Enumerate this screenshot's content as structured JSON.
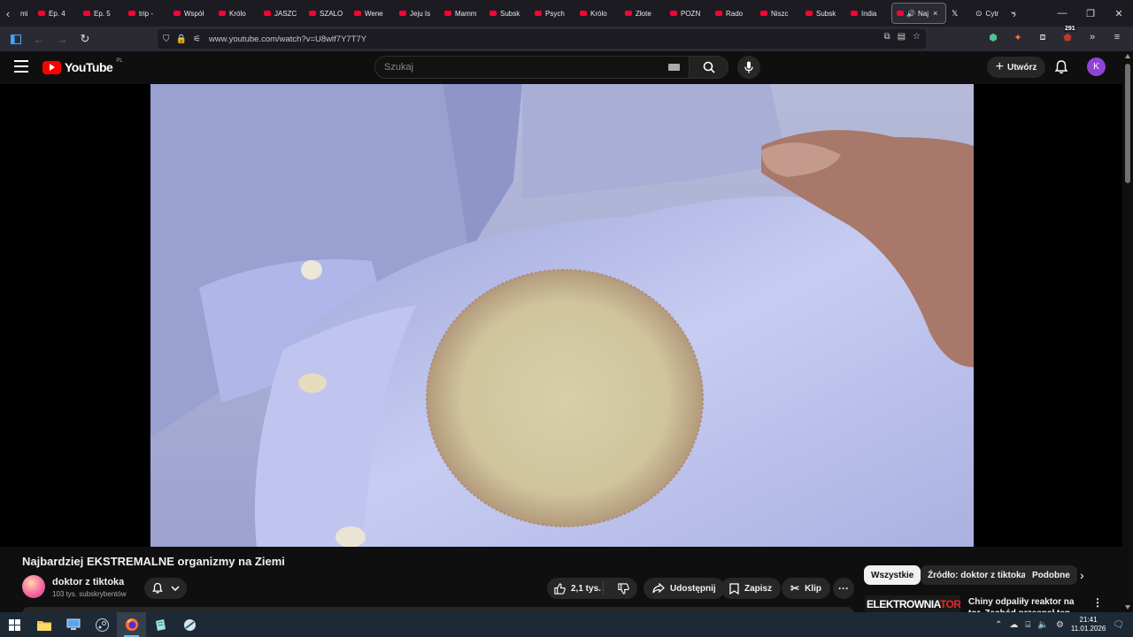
{
  "browser": {
    "tabs": [
      {
        "label": "mi",
        "favicon": "none"
      },
      {
        "label": "Ep. 4",
        "favicon": "youtube-icon"
      },
      {
        "label": "Ep. 5",
        "favicon": "youtube-icon"
      },
      {
        "label": "trip -",
        "favicon": "youtube-icon"
      },
      {
        "label": "Współ",
        "favicon": "youtube-icon"
      },
      {
        "label": "Królo",
        "favicon": "youtube-icon"
      },
      {
        "label": "JASZC",
        "favicon": "youtube-icon"
      },
      {
        "label": "SZALO",
        "favicon": "youtube-icon"
      },
      {
        "label": "Wene",
        "favicon": "youtube-icon"
      },
      {
        "label": "Jeju Is",
        "favicon": "youtube-icon"
      },
      {
        "label": "Mamm",
        "favicon": "youtube-icon"
      },
      {
        "label": "Subsk",
        "favicon": "youtube-icon"
      },
      {
        "label": "Psych",
        "favicon": "youtube-icon"
      },
      {
        "label": "Królo",
        "favicon": "youtube-icon"
      },
      {
        "label": "Złote",
        "favicon": "youtube-icon"
      },
      {
        "label": "POZN",
        "favicon": "youtube-icon"
      },
      {
        "label": "Rado",
        "favicon": "youtube-icon"
      },
      {
        "label": "Niszc",
        "favicon": "youtube-icon"
      },
      {
        "label": "Subsk",
        "favicon": "youtube-icon"
      },
      {
        "label": "India",
        "favicon": "youtube-icon"
      }
    ],
    "active_tab": {
      "label": "Naj",
      "close": "×"
    },
    "extra_tab": {
      "label": "Cytr",
      "favicon": "x-icon"
    },
    "url": "www.youtube.com/watch?v=U8wlf7Y7T7Y",
    "extension_badge": "291"
  },
  "youtube": {
    "logo_text": "YouTube",
    "country_code": "PL",
    "search_placeholder": "Szukaj",
    "create_label": "Utwórz",
    "avatar_letter": "K"
  },
  "video": {
    "title": "Najbardziej EKSTREMALNE organizmy na Ziemi",
    "channel": "doktor z tiktoka",
    "subscribers": "103 tys. subskrybentów",
    "likes": "2,1 tys.",
    "share_label": "Udostępnij",
    "save_label": "Zapisz",
    "clip_label": "Klip"
  },
  "chips": [
    "Wszystkie",
    "Źródło: doktor z tiktoka",
    "Podobne"
  ],
  "recommendation": {
    "thumb_text_a": "ELEKTROWNIA",
    "thumb_text_b": "TOROWA",
    "thumb_text_c": "?",
    "title": "Chiny odpaliły reaktor na tor. Zachód przespał ten moment?"
  },
  "taskbar": {
    "time": "21:41",
    "date": "11.01.2026"
  },
  "colors": {
    "yt_red": "#ff0000",
    "avatar_purple": "#8e44d6",
    "background": "#0f0f0f"
  }
}
